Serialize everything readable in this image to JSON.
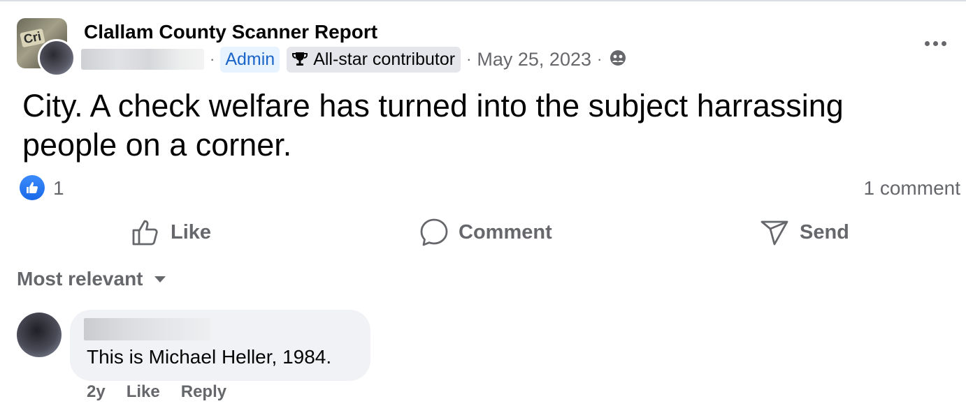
{
  "post": {
    "group_name": "Clallam County Scanner Report",
    "separator": "·",
    "admin_badge": "Admin",
    "contributor_badge": "All-star contributor",
    "date": "May 25, 2023",
    "text": "City. A check welfare has turned into the subject harrassing people on a corner.",
    "group_avatar_text": "Cri",
    "icons": {
      "more": "more-horizontal-icon",
      "privacy": "group-members-icon",
      "trophy": "trophy-icon"
    }
  },
  "reactions": {
    "like_count": "1",
    "comment_count": "1 comment",
    "accent": "#1877f2"
  },
  "actions": {
    "like": "Like",
    "comment": "Comment",
    "send": "Send"
  },
  "comments_section": {
    "sort_label": "Most relevant",
    "comments": [
      {
        "text": "This is Michael Heller, 1984.",
        "age": "2y",
        "like": "Like",
        "reply": "Reply"
      }
    ]
  }
}
